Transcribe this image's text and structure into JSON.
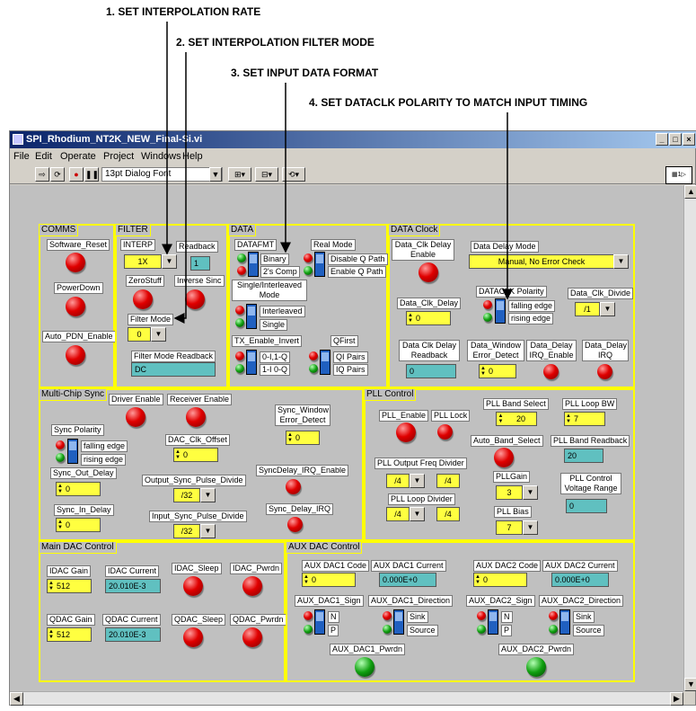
{
  "callouts": {
    "c1": "1. SET INTERPOLATION RATE",
    "c2": "2. SET INTERPOLATION FILTER MODE",
    "c3": "3. SET INPUT DATA FORMAT",
    "c4": "4. SET DATACLK POLARITY TO MATCH INPUT TIMING"
  },
  "window": {
    "title": "SPI_Rhodium_NT2K_NEW_Final-Si.vi",
    "menu": [
      "File",
      "Edit",
      "Operate",
      "Project",
      "Windows",
      "Help"
    ],
    "font_selector": "13pt Dialog Font"
  },
  "comms": {
    "title": "COMMS",
    "software_reset": "Software_Reset",
    "powerdown": "PowerDown",
    "auto_pdn": "Auto_PDN_Enable"
  },
  "filter": {
    "title": "FILTER",
    "interp_label": "INTERP",
    "interp_value": "1X",
    "readback_label": "Readback",
    "readback_value": "1",
    "zerostuff": "ZeroStuff",
    "inverse_sinc": "Inverse Sinc",
    "filter_mode_label": "Filter Mode",
    "filter_mode_value": "0",
    "filter_mode_readback_label": "Filter Mode Readback",
    "filter_mode_readback_value": "DC"
  },
  "data": {
    "title": "DATA",
    "datafmt_label": "DATAFMT",
    "binary": "Binary",
    "twos_comp": "2's Comp",
    "real_mode": "Real Mode",
    "disable_q": "Disable Q Path",
    "enable_q": "Enable Q Path",
    "single_interleaved": "Single/Interleaved Mode",
    "interleaved": "Interleaved",
    "single": "Single",
    "tx_enable_invert": "TX_Enable_Invert",
    "opt_0i1q": "0-I,1-Q",
    "opt_1i0q": "1-I 0-Q",
    "qfirst": "QFirst",
    "qi_pairs": "QI Pairs",
    "iq_pairs": "IQ Pairs"
  },
  "data_clock": {
    "title": "DATA Clock",
    "clk_delay_enable": "Data_Clk Delay Enable",
    "delay_mode_label": "Data Delay Mode",
    "delay_mode_value": "Manual, No Error Check",
    "dataclk_polarity": "DATACLK Polarity",
    "falling_edge": "falling edge",
    "rising_edge": "rising edge",
    "clk_divide_label": "Data_Clk_Divide",
    "clk_divide_value": "/1",
    "clk_delay_label": "Data_Clk_Delay",
    "clk_delay_value": "0",
    "clk_delay_readback_label": "Data Clk Delay Readback",
    "clk_delay_readback_value": "0",
    "window_error_label": "Data_Window Error_Detect",
    "window_error_value": "0",
    "delay_irq_enable": "Data_Delay IRQ_Enable",
    "delay_irq": "Data_Delay IRQ"
  },
  "multichip": {
    "title": "Multi-Chip Sync",
    "driver_enable": "Driver Enable",
    "receiver_enable": "Receiver Enable",
    "sync_window_error": "Sync_Window Error_Detect",
    "sync_window_error_value": "0",
    "sync_polarity": "Sync Polarity",
    "falling_edge": "falling edge",
    "rising_edge": "rising edge",
    "dac_clk_offset": "DAC_Clk_Offset",
    "dac_clk_offset_value": "0",
    "sync_out_delay": "Sync_Out_Delay",
    "sync_out_delay_value": "0",
    "output_sync_pulse_divide": "Output_Sync_Pulse_Divide",
    "output_sync_pulse_divide_value": "/32",
    "syncdelay_irq_enable": "SyncDelay_IRQ_Enable",
    "sync_in_delay": "Sync_In_Delay",
    "sync_in_delay_value": "0",
    "input_sync_pulse_divide": "Input_Sync_Pulse_Divide",
    "input_sync_pulse_divide_value": "/32",
    "sync_delay_irq": "Sync_Delay_IRQ"
  },
  "pll": {
    "title": "PLL Control",
    "pll_enable": "PLL_Enable",
    "pll_lock": "PLL Lock",
    "band_select_label": "PLL Band Select",
    "band_select_value": "20",
    "loop_bw_label": "PLL Loop BW",
    "loop_bw_value": "7",
    "auto_band_select": "Auto_Band_Select",
    "band_readback_label": "PLL Band Readback",
    "band_readback_value": "20",
    "output_freq_divider_label": "PLL Output Freq Divider",
    "output_freq_divider_value": "/4",
    "output_freq_divider_readback": "/4",
    "gain_label": "PLLGain",
    "gain_value": "3",
    "control_voltage_label": "PLL Control Voltage Range",
    "control_voltage_value": "0",
    "loop_divider_label": "PLL Loop Divider",
    "loop_divider_value": "/4",
    "loop_divider_readback": "/4",
    "bias_label": "PLL Bias",
    "bias_value": "7"
  },
  "main_dac": {
    "title": "Main DAC Control",
    "idac_gain_label": "IDAC Gain",
    "idac_gain_value": "512",
    "idac_current_label": "IDAC Current",
    "idac_current_value": "20.010E-3",
    "idac_sleep": "IDAC_Sleep",
    "idac_pwrdn": "IDAC_Pwrdn",
    "qdac_gain_label": "QDAC Gain",
    "qdac_gain_value": "512",
    "qdac_current_label": "QDAC Current",
    "qdac_current_value": "20.010E-3",
    "qdac_sleep": "QDAC_Sleep",
    "qdac_pwrdn": "QDAC_Pwrdn"
  },
  "aux_dac": {
    "title": "AUX DAC Control",
    "dac1_code_label": "AUX DAC1 Code",
    "dac1_code_value": "0",
    "dac1_current_label": "AUX DAC1 Current",
    "dac1_current_value": "0.000E+0",
    "dac2_code_label": "AUX DAC2 Code",
    "dac2_code_value": "0",
    "dac2_current_label": "AUX DAC2 Current",
    "dac2_current_value": "0.000E+0",
    "dac1_sign": "AUX_DAC1_Sign",
    "dac1_direction": "AUX_DAC1_Direction",
    "dac2_sign": "AUX_DAC2_Sign",
    "dac2_direction": "AUX_DAC2_Direction",
    "n": "N",
    "p": "P",
    "sink": "Sink",
    "source": "Source",
    "dac1_pwrdn": "AUX_DAC1_Pwrdn",
    "dac2_pwrdn": "AUX_DAC2_Pwrdn"
  }
}
